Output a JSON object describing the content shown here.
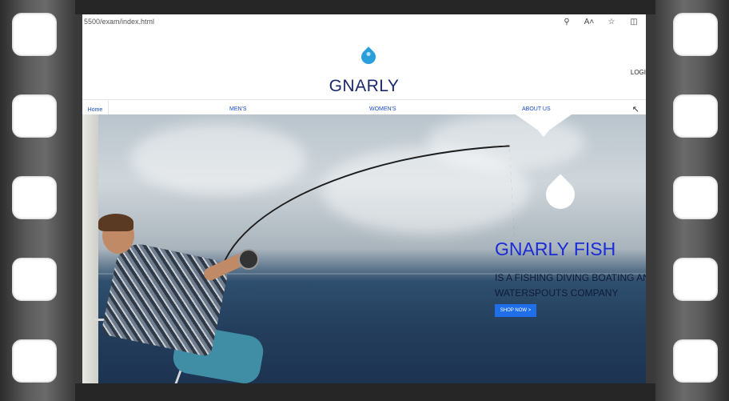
{
  "browser": {
    "url": "5500/exam/index.html",
    "icons": [
      "search-icon",
      "read-aloud-icon",
      "favorite-star-icon",
      "split-screen-icon"
    ]
  },
  "header": {
    "brand": "GNARLY",
    "login": "LOGI"
  },
  "nav": {
    "home": "Home",
    "mens": "MEN'S",
    "womens": "WOMEN'S",
    "about": "ABOUT US"
  },
  "hero": {
    "title": "GNARLY FISH",
    "subtitle_line1": "IS A FISHING DIVING BOATING AN",
    "subtitle_line2": "WATERSPOUTS COMPANY",
    "button": "SHOP NOW >"
  },
  "colors": {
    "brand_navy": "#1a2a6c",
    "hero_title_blue": "#1a2bd8",
    "button_blue": "#1f6feb",
    "nav_link_blue": "#1a4ac4",
    "logo_drop": "#2b9fd9"
  }
}
